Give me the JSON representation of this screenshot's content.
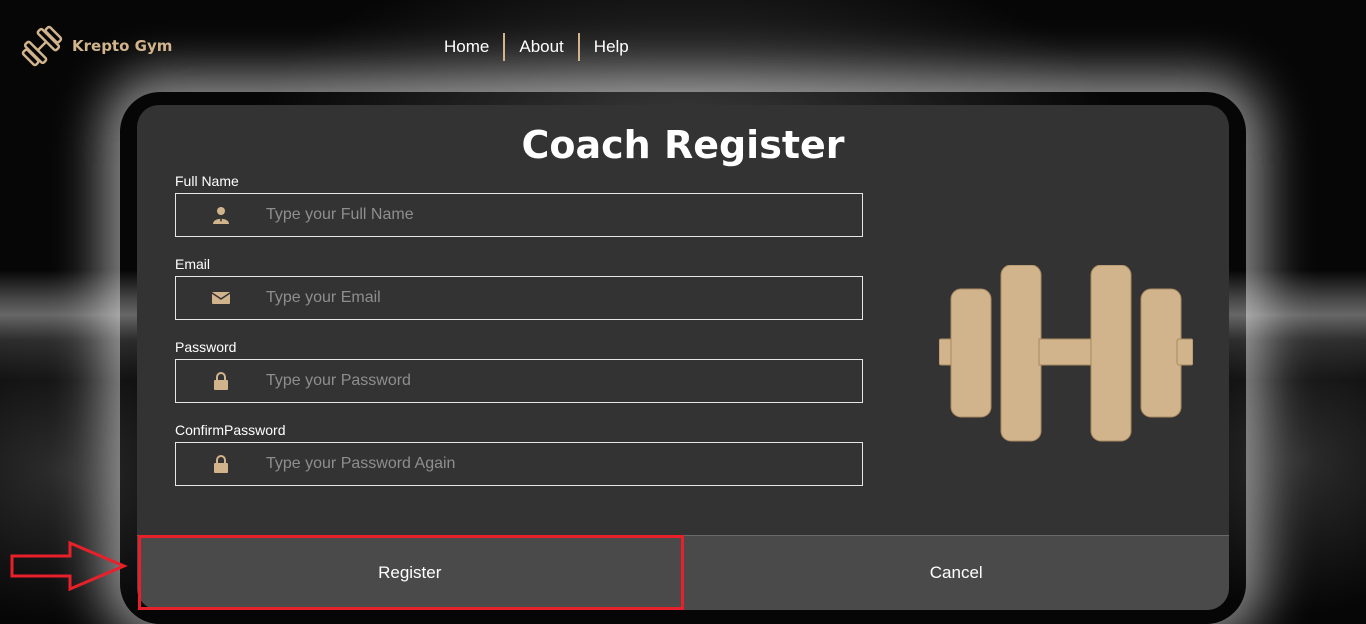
{
  "brand": {
    "name": "Krepto Gym",
    "logo_icon": "dumbbell-icon",
    "accent": "#d2b48c"
  },
  "nav": {
    "items": [
      "Home",
      "About",
      "Help"
    ]
  },
  "form": {
    "title": "Coach Register",
    "fields": [
      {
        "label": "Full Name",
        "placeholder": "Type your Full Name",
        "value": "",
        "icon": "user-icon"
      },
      {
        "label": "Email",
        "placeholder": "Type your Email",
        "value": "",
        "icon": "envelope-icon"
      },
      {
        "label": "Password",
        "placeholder": "Type your Password",
        "value": "",
        "icon": "lock-icon"
      },
      {
        "label": "ConfirmPassword",
        "placeholder": "Type your Password Again",
        "value": "",
        "icon": "lock-icon"
      }
    ],
    "register_label": "Register",
    "cancel_label": "Cancel"
  },
  "annotation": {
    "highlight_color": "#e8202a"
  }
}
